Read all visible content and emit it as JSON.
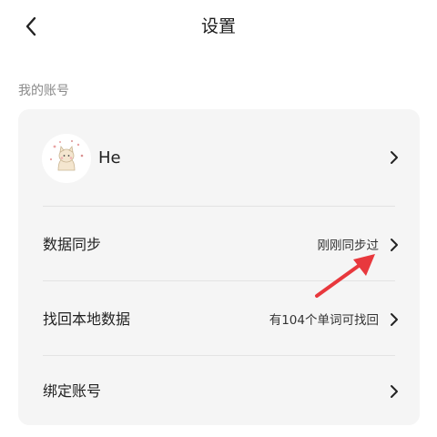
{
  "nav": {
    "title": "设置",
    "back_icon": "chevron-left-icon"
  },
  "section": {
    "label": "我的账号"
  },
  "account": {
    "username": "He",
    "avatar_icon": "cat-avatar-icon"
  },
  "rows": {
    "sync": {
      "label": "数据同步",
      "value": "刚刚同步过"
    },
    "recover": {
      "label": "找回本地数据",
      "value": "有104个单词可找回"
    },
    "bind": {
      "label": "绑定账号"
    }
  },
  "colors": {
    "card_background": "#f5f5f5",
    "annotation_arrow": "#e8383d",
    "section_label": "#8a8a8a"
  }
}
